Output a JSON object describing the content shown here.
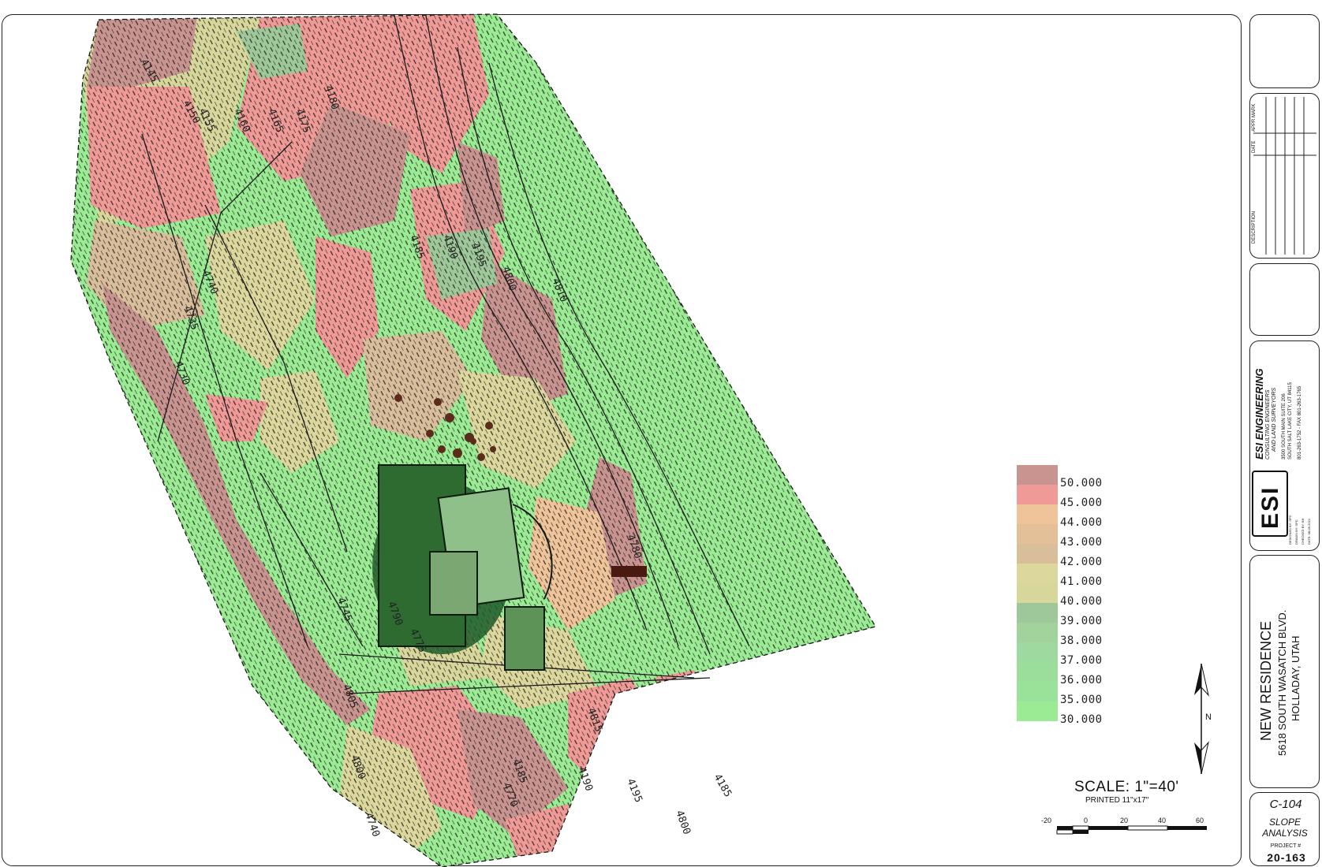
{
  "legend": {
    "items": [
      {
        "label": "50.000",
        "color": "#c9948f"
      },
      {
        "label": "45.000",
        "color": "#ef9a96"
      },
      {
        "label": "44.000",
        "color": "#efc49a"
      },
      {
        "label": "43.000",
        "color": "#e4c098"
      },
      {
        "label": "42.000",
        "color": "#d9be9c"
      },
      {
        "label": "41.000",
        "color": "#dcd79c"
      },
      {
        "label": "40.000",
        "color": "#d7d79c"
      },
      {
        "label": "39.000",
        "color": "#9fc89a"
      },
      {
        "label": "38.000",
        "color": "#a3d39d"
      },
      {
        "label": "37.000",
        "color": "#9ed9a0"
      },
      {
        "label": "36.000",
        "color": "#9bde9b"
      },
      {
        "label": "35.000",
        "color": "#9ae29a"
      },
      {
        "label": "30.000",
        "color": "#9aeb93"
      }
    ]
  },
  "contour_labels": [
    "4145",
    "4150",
    "4155",
    "4160",
    "4165",
    "4175",
    "4180",
    "4185",
    "4190",
    "4195",
    "4800",
    "4810",
    "4740",
    "4735",
    "4730",
    "4745",
    "4775",
    "4780",
    "4790",
    "4805",
    "4800",
    "4815",
    "4185",
    "4190",
    "4195",
    "4800",
    "4740",
    "4770",
    "4185"
  ],
  "scale": {
    "title": "SCALE: 1\"=40'",
    "printed": "PRINTED 11\"x17\"",
    "ticks": [
      "-20",
      "0",
      "20",
      "40",
      "60"
    ]
  },
  "north_label": "N",
  "title_block": {
    "revision_headers": [
      "DESCRIPTION",
      "DATE",
      "APPR",
      "MARK"
    ],
    "firm_name": "ESI ENGINEERING",
    "firm_sub1": "CONSULTING ENGINEERS",
    "firm_sub2": "AND LAND SURVEYORS",
    "firm_addr1": "3500 SOUTH MAIN SUITE 206",
    "firm_addr2": "SOUTH SALT LAKE CITY, UT 84115",
    "firm_phone": "801-263-1752 - FAX 801-263-1765",
    "logo_text": "ESI",
    "designed_by": "DESIGNED BY: SPC",
    "drawn_by": "DRAWN BY: SPC",
    "checked_by": "CHECKED BY: BH",
    "date": "DATE: 08-05-2021",
    "project_title": "NEW RESIDENCE",
    "address": "5618 SOUTH WASATCH BLVD.",
    "city": "HOLLADAY, UTAH",
    "sheet_number": "C-104",
    "sheet_title_1": "SLOPE",
    "sheet_title_2": "ANALYSIS",
    "project_label": "PROJECT #",
    "project_number": "20-163"
  }
}
